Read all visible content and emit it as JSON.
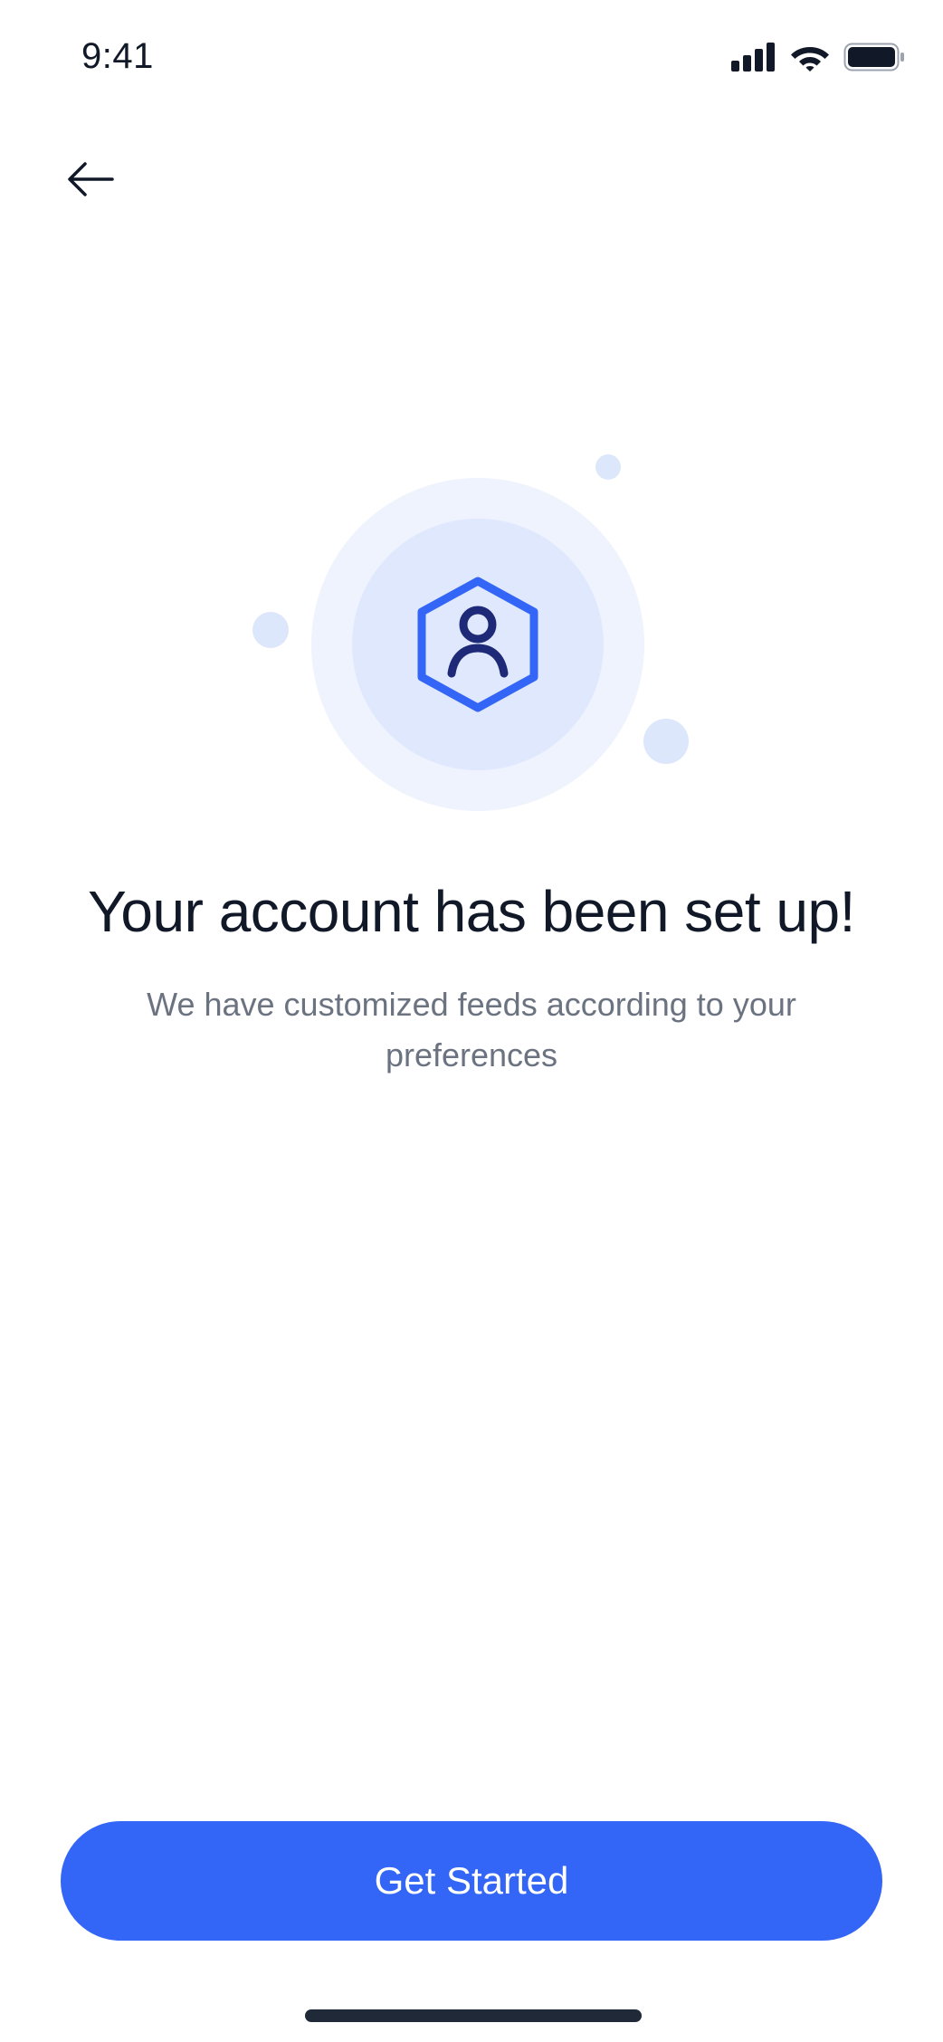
{
  "status_bar": {
    "time": "9:41",
    "icons": [
      "cellular-signal-icon",
      "wifi-icon",
      "battery-icon"
    ]
  },
  "navigation": {
    "back_icon": "arrow-left-icon"
  },
  "illustration": {
    "icon": "user-hexagon-icon"
  },
  "content": {
    "title": "Your account has been set up!",
    "subtitle": "We have customized feeds according to your preferences"
  },
  "actions": {
    "primary_label": "Get Started"
  },
  "colors": {
    "primary": "#3366f6",
    "icon_dark": "#1e2a78",
    "circle_outer": "#eef3fe",
    "circle_inner": "#dfe8fc",
    "bubble": "#dde7fb",
    "title_text": "#111827",
    "subtitle_text": "#6b7280"
  }
}
